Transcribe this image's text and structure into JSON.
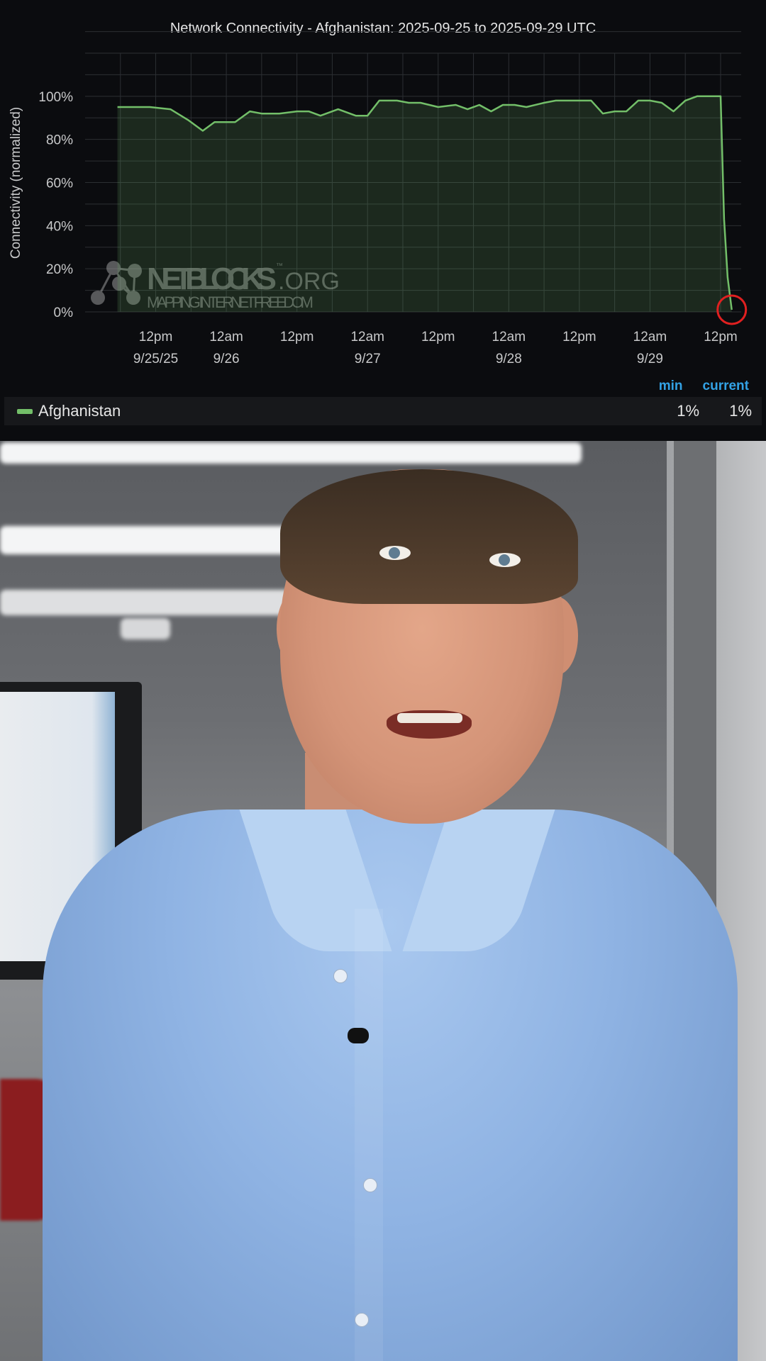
{
  "chart_data": {
    "type": "area",
    "title": "Network Connectivity - Afghanistan: 2025-09-25 to 2025-09-29 UTC",
    "ylabel": "Connectivity (normalized)",
    "xlabel": "",
    "ylim": [
      0,
      120
    ],
    "yticks": [
      "0%",
      "20%",
      "40%",
      "60%",
      "80%",
      "100%"
    ],
    "xticks": [
      {
        "t": 12,
        "l1": "12pm",
        "l2": "9/25/25"
      },
      {
        "t": 24,
        "l1": "12am",
        "l2": "9/26"
      },
      {
        "t": 36,
        "l1": "12pm",
        "l2": ""
      },
      {
        "t": 48,
        "l1": "12am",
        "l2": "9/27"
      },
      {
        "t": 60,
        "l1": "12pm",
        "l2": ""
      },
      {
        "t": 72,
        "l1": "12am",
        "l2": "9/28"
      },
      {
        "t": 84,
        "l1": "12pm",
        "l2": ""
      },
      {
        "t": 96,
        "l1": "12am",
        "l2": "9/29"
      },
      {
        "t": 108,
        "l1": "12pm",
        "l2": ""
      }
    ],
    "grid": true,
    "legend_position": "bottom",
    "series": [
      {
        "name": "Afghanistan",
        "color": "#73bf69",
        "x": [
          5.5,
          11,
          14.5,
          17.5,
          20,
          22,
          24,
          25.5,
          28,
          30,
          33,
          36,
          38,
          40,
          43,
          46,
          48,
          50,
          53,
          55,
          57,
          60,
          63,
          65,
          67,
          69,
          71,
          73,
          75,
          78,
          80,
          82,
          84,
          86,
          88,
          90,
          92,
          94,
          96,
          98,
          100,
          102,
          104,
          106,
          108,
          108.6,
          109.2,
          109.9
        ],
        "y": [
          95,
          95,
          94,
          89,
          84,
          88,
          88,
          88,
          93,
          92,
          92,
          93,
          93,
          91,
          94,
          91,
          91,
          98,
          98,
          97,
          97,
          95,
          96,
          94,
          96,
          93,
          96,
          96,
          95,
          97,
          98,
          98,
          98,
          98,
          92,
          93,
          93,
          98,
          98,
          97,
          93,
          98,
          100,
          100,
          100,
          43,
          16,
          1
        ]
      }
    ],
    "highlight_circle": {
      "x": 109.9,
      "y": 1
    }
  },
  "watermark": {
    "brand": "NETBLOCKS",
    "suffix": ".ORG",
    "tm": "™",
    "tagline": "MAPPING INTERNET FREEDOM"
  },
  "legend": {
    "min_header": "min",
    "current_header": "current",
    "series_name": "Afghanistan",
    "series_color": "#73bf69",
    "min_value": "1%",
    "current_value": "1%"
  }
}
